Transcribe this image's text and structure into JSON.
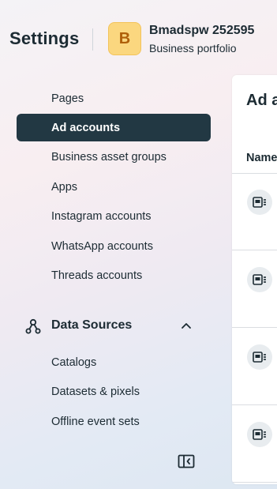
{
  "header": {
    "title": "Settings",
    "portfolio": {
      "avatar_letter": "B",
      "name": "Bmadspw 252595",
      "subtitle": "Business portfolio"
    }
  },
  "sidebar": {
    "accounts_items": [
      {
        "label": "Pages",
        "active": false
      },
      {
        "label": "Ad accounts",
        "active": true
      },
      {
        "label": "Business asset groups",
        "active": false
      },
      {
        "label": "Apps",
        "active": false
      },
      {
        "label": "Instagram accounts",
        "active": false
      },
      {
        "label": "WhatsApp accounts",
        "active": false
      },
      {
        "label": "Threads accounts",
        "active": false
      }
    ],
    "data_sources": {
      "label": "Data Sources",
      "expanded": true,
      "icon": "data-sources-icon",
      "items": [
        {
          "label": "Catalogs"
        },
        {
          "label": "Datasets & pixels"
        },
        {
          "label": "Offline event sets"
        }
      ]
    }
  },
  "main": {
    "title": "Ad accounts",
    "title_visible": "Ad acco",
    "columns": [
      "Name"
    ],
    "rows": [
      {
        "icon": "ad-account-icon"
      },
      {
        "icon": "ad-account-icon"
      },
      {
        "icon": "ad-account-icon"
      },
      {
        "icon": "ad-account-icon"
      }
    ]
  },
  "colors": {
    "active_bg": "#223843",
    "avatar_bg": "#fbd77f",
    "avatar_text": "#b0600a",
    "text": "#1c2b33"
  }
}
